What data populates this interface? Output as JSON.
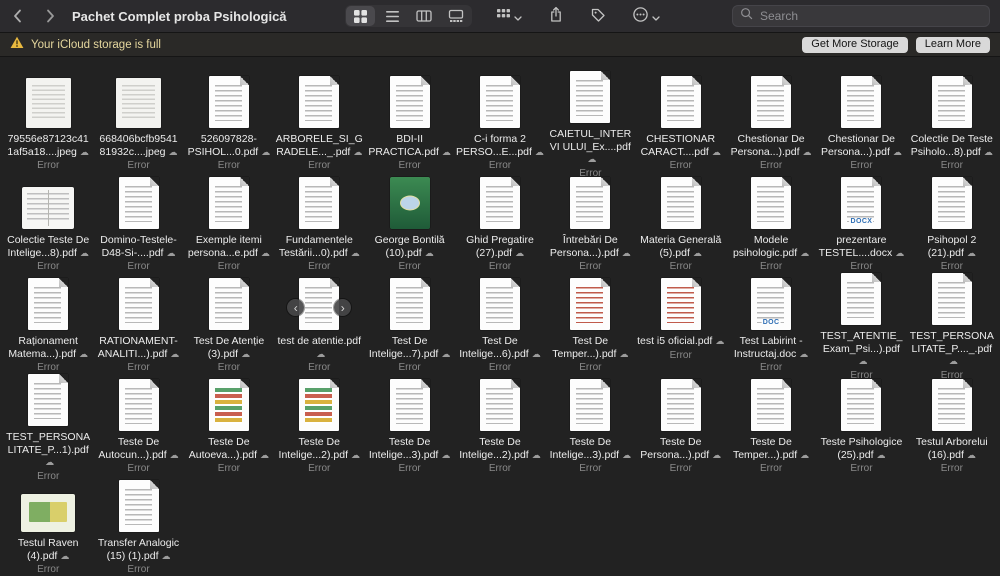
{
  "toolbar": {
    "title": "Pachet Complet proba Psihologică",
    "search_placeholder": "Search"
  },
  "banner": {
    "message": "Your iCloud storage is full",
    "get_more_label": "Get More Storage",
    "learn_more_label": "Learn More"
  },
  "icons": {
    "cloud": "☁",
    "prev_arrow": "‹",
    "next_arrow": "›"
  },
  "colors": {
    "background": "#222222",
    "toolbar_bg": "#2c2b2e",
    "banner_text": "#e5d79e",
    "banner_button_bg": "#d9d9d9",
    "selected_view_bg": "#4a494d",
    "warning_yellow": "#e8b83f"
  },
  "files": [
    {
      "name": "79556e87123c41 1af5a18....jpeg",
      "status": "Error",
      "thumb": "scan"
    },
    {
      "name": "668406bcfb9541 81932c....jpeg",
      "status": "Error",
      "thumb": "scan"
    },
    {
      "name": "526097828-PSIHOL...0.pdf",
      "status": "Error",
      "thumb": "page"
    },
    {
      "name": "ARBORELE_SI_G RADELE..._.pdf",
      "status": "Error",
      "thumb": "page"
    },
    {
      "name": "BDI-II PRACTICA.pdf",
      "status": "Error",
      "thumb": "page"
    },
    {
      "name": "C-i forma 2 PERSO...E...pdf",
      "status": "Error",
      "thumb": "page"
    },
    {
      "name": "CAIETUL_INTERVI ULUI_Ex....pdf",
      "status": "Error",
      "thumb": "page"
    },
    {
      "name": "CHESTIONAR CARACT....pdf",
      "status": "Error",
      "thumb": "page"
    },
    {
      "name": "Chestionar De Persona...).pdf",
      "status": "Error",
      "thumb": "page"
    },
    {
      "name": "Chestionar De Persona...).pdf",
      "status": "Error",
      "thumb": "page"
    },
    {
      "name": "Colectie De Teste Psiholo...8).pdf",
      "status": "Error",
      "thumb": "page"
    },
    {
      "name": "Colectie Teste De Intelige...8).pdf",
      "status": "Error",
      "thumb": "open"
    },
    {
      "name": "Domino-Testele-D48-Si-....pdf",
      "status": "Error",
      "thumb": "page"
    },
    {
      "name": "Exemple itemi persona...e.pdf",
      "status": "Error",
      "thumb": "page"
    },
    {
      "name": "Fundamentele Testării...0).pdf",
      "status": "Error",
      "thumb": "page"
    },
    {
      "name": "George Bontilă (10).pdf",
      "status": "Error",
      "thumb": "book"
    },
    {
      "name": "Ghid Pregatire (27).pdf",
      "status": "Error",
      "thumb": "page"
    },
    {
      "name": "Întrebări De Persona...).pdf",
      "status": "Error",
      "thumb": "page"
    },
    {
      "name": "Materia Generală (5).pdf",
      "status": "Error",
      "thumb": "page"
    },
    {
      "name": "Modele psihologic.pdf",
      "status": "Error",
      "thumb": "page"
    },
    {
      "name": "prezentare TESTEL....docx",
      "status": "Error",
      "thumb": "page",
      "badge": "DOCX"
    },
    {
      "name": "Psihopol 2 (21).pdf",
      "status": "Error",
      "thumb": "page"
    },
    {
      "name": "Raționament Matema...).pdf",
      "status": "Error",
      "thumb": "page"
    },
    {
      "name": "RATIONAMENT-ANALITI...).pdf",
      "status": "Error",
      "thumb": "page"
    },
    {
      "name": "Test De Atenție (3).pdf",
      "status": "Error",
      "thumb": "page"
    },
    {
      "name": "test de atentie.pdf",
      "status": "Error",
      "thumb": "page",
      "nav_overlay": true
    },
    {
      "name": "Test De Intelige...7).pdf",
      "status": "Error",
      "thumb": "page"
    },
    {
      "name": "Test De Intelige...6).pdf",
      "status": "Error",
      "thumb": "page"
    },
    {
      "name": "Test De Temper...).pdf",
      "status": "Error",
      "thumb": "red"
    },
    {
      "name": "test i5 oficial.pdf",
      "status": "Error",
      "thumb": "red"
    },
    {
      "name": "Test Labirint - Instructaj.doc",
      "status": "Error",
      "thumb": "page",
      "badge": "DOC"
    },
    {
      "name": "TEST_ATENTIE_Exam_Psi...).pdf",
      "status": "Error",
      "thumb": "page"
    },
    {
      "name": "TEST_PERSONALITATE_P...._.pdf",
      "status": "Error",
      "thumb": "page"
    },
    {
      "name": "TEST_PERSONALITATE_P...1).pdf",
      "status": "Error",
      "thumb": "page"
    },
    {
      "name": "Teste De Autocun...).pdf",
      "status": "Error",
      "thumb": "page"
    },
    {
      "name": "Teste De Autoeva...).pdf",
      "status": "Error",
      "thumb": "color"
    },
    {
      "name": "Teste De Intelige...2).pdf",
      "status": "Error",
      "thumb": "color"
    },
    {
      "name": "Teste De Intelige...3).pdf",
      "status": "Error",
      "thumb": "page"
    },
    {
      "name": "Teste De Intelige...2).pdf",
      "status": "Error",
      "thumb": "page"
    },
    {
      "name": "Teste De Intelige...3).pdf",
      "status": "Error",
      "thumb": "page"
    },
    {
      "name": "Teste De Persona...).pdf",
      "status": "Error",
      "thumb": "page"
    },
    {
      "name": "Teste De Temper...).pdf",
      "status": "Error",
      "thumb": "page"
    },
    {
      "name": "Teste Psihologice (25).pdf",
      "status": "Error",
      "thumb": "page"
    },
    {
      "name": "Testul Arborelui (16).pdf",
      "status": "Error",
      "thumb": "page"
    },
    {
      "name": "Testul Raven (4).pdf",
      "status": "Error",
      "thumb": "slide"
    },
    {
      "name": "Transfer Analogic (15) (1).pdf",
      "status": "Error",
      "thumb": "page"
    }
  ]
}
